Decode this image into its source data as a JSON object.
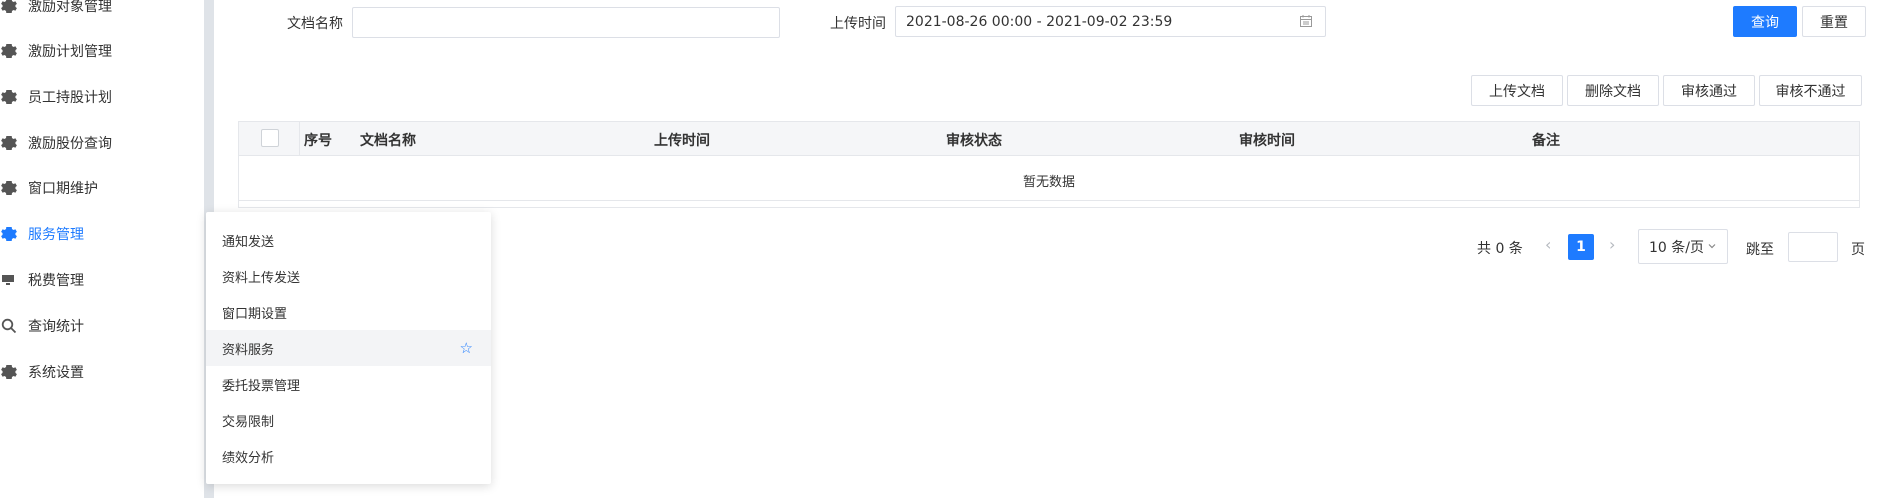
{
  "sidebar": {
    "items": [
      {
        "label": "激励对象管理",
        "icon": "gear-icon"
      },
      {
        "label": "激励计划管理",
        "icon": "gear-icon"
      },
      {
        "label": "员工持股计划",
        "icon": "gear-icon"
      },
      {
        "label": "激励股份查询",
        "icon": "gear-icon"
      },
      {
        "label": "窗口期维护",
        "icon": "gear-icon"
      },
      {
        "label": "服务管理",
        "icon": "gear-icon",
        "active": true
      },
      {
        "label": "税费管理",
        "icon": "monitor-icon"
      },
      {
        "label": "查询统计",
        "icon": "search-icon"
      },
      {
        "label": "系统设置",
        "icon": "gear-icon"
      }
    ]
  },
  "form": {
    "doc_name_label": "文档名称",
    "doc_name_value": "",
    "upload_time_label": "上传时间",
    "upload_time_value": "2021-08-26 00:00 - 2021-09-02 23:59",
    "query_label": "查询",
    "reset_label": "重置"
  },
  "actions": {
    "upload_label": "上传文档",
    "delete_label": "删除文档",
    "approve_label": "审核通过",
    "reject_label": "审核不通过"
  },
  "table": {
    "columns": [
      "序号",
      "文档名称",
      "上传时间",
      "审核状态",
      "审核时间",
      "备注"
    ],
    "empty_text": "暂无数据"
  },
  "pagination": {
    "total_text": "共 0 条",
    "current_page": "1",
    "page_size": "10 条/页",
    "jump_label": "跳至",
    "page_suffix": "页",
    "jump_value": ""
  },
  "submenu": {
    "items": [
      {
        "label": "通知发送"
      },
      {
        "label": "资料上传发送"
      },
      {
        "label": "窗口期设置"
      },
      {
        "label": "资料服务",
        "hovered": true,
        "star": "☆"
      },
      {
        "label": "委托投票管理"
      },
      {
        "label": "交易限制"
      },
      {
        "label": "绩效分析"
      }
    ]
  },
  "colors": {
    "primary": "#1e7bff",
    "sidebar_strip": "#dfe3e8"
  }
}
